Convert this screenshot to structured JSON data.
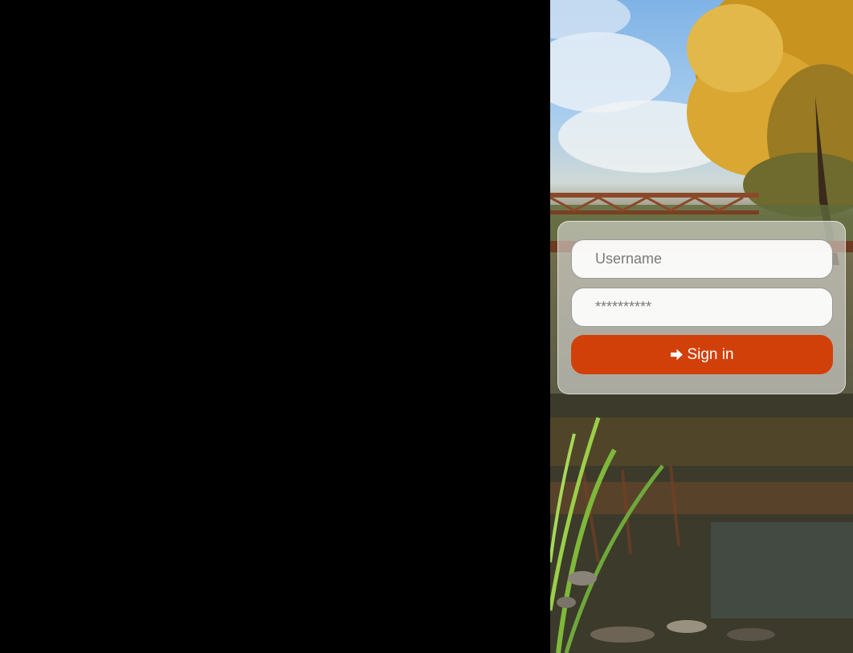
{
  "login": {
    "username_placeholder": "Username",
    "password_placeholder": "**********",
    "signin_label": "Sign in",
    "signin_icon": "sign-in-arrow-icon",
    "accent_color": "#d2400a"
  }
}
